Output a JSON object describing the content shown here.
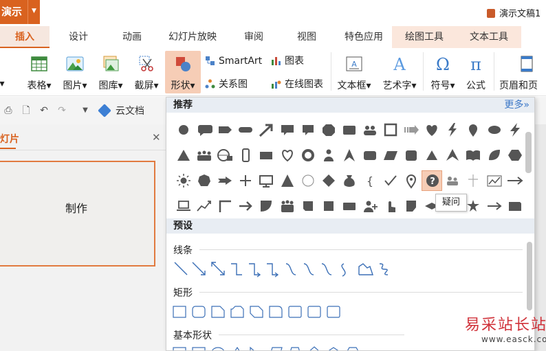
{
  "app": {
    "menu_label": "演示",
    "doc_title": "演示文稿1"
  },
  "tabs": [
    {
      "label": "插入",
      "active": true
    },
    {
      "label": "设计"
    },
    {
      "label": "动画"
    },
    {
      "label": "幻灯片放映"
    },
    {
      "label": "审阅"
    },
    {
      "label": "视图"
    },
    {
      "label": "特色应用"
    },
    {
      "label": "绘图工具"
    },
    {
      "label": "文本工具"
    }
  ],
  "ribbon": {
    "table": "表格",
    "picture": "图片",
    "gallery": "图库",
    "screenshot": "截屏",
    "shapes": "形状",
    "smartart": "SmartArt",
    "chart": "图表",
    "relation": "关系图",
    "online_chart": "在线图表",
    "textbox": "文本框",
    "wordart": "艺术字",
    "symbol": "符号",
    "formula": "公式",
    "header_footer": "页眉和页"
  },
  "quickbar": {
    "cloud_doc": "云文档"
  },
  "slides_panel": {
    "tab_label": "灯片",
    "slide_text": "制作"
  },
  "shapes_menu": {
    "recommended_title": "推荐",
    "more_label": "更多»",
    "preset_title": "预设",
    "lines_label": "线条",
    "rect_label": "矩形",
    "basic_label": "基本形状",
    "tooltip": "疑问"
  },
  "watermark": {
    "cn": "易采站长站",
    "url": "www.easck.com"
  },
  "colors": {
    "accent": "#d9621f",
    "shape_fill": "#555555",
    "link": "#3c78c8",
    "watermark": "#d0323a"
  }
}
